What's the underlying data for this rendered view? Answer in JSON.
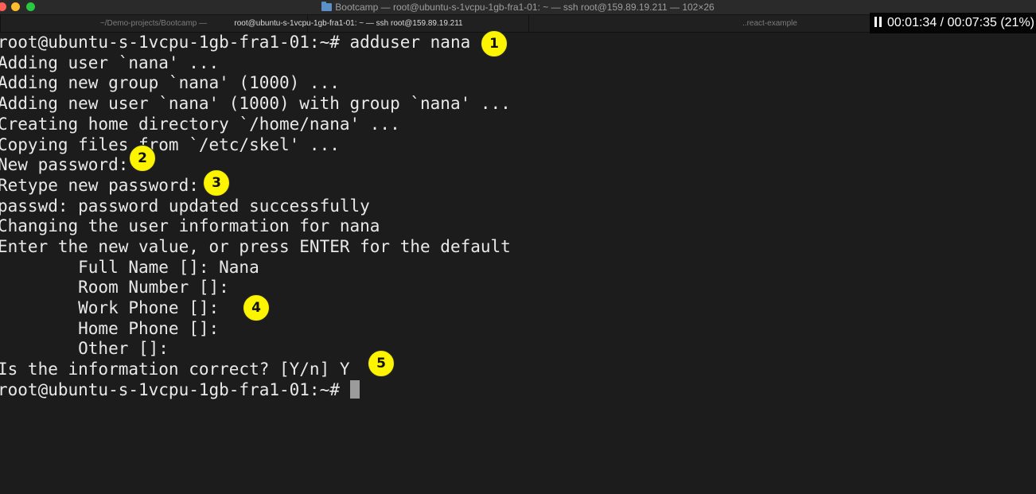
{
  "window": {
    "title": "Bootcamp — root@ubuntu-s-1vcpu-1gb-fra1-01: ~ — ssh root@159.89.19.211 — 102×26",
    "folder_icon": "folder-icon",
    "traffic_lights": [
      "#fe5f57",
      "#febc2e",
      "#28c840"
    ]
  },
  "tabs": [
    {
      "label": "~/Demo-projects/Bootcamp — ",
      "strong": "",
      "active": false
    },
    {
      "label": "",
      "strong": "root@ubuntu-s-1vcpu-1gb-fra1-01: ~ — ssh root@159.89.19.211",
      "active": true
    },
    {
      "label": "..react-example",
      "strong": "",
      "active": false
    }
  ],
  "player": {
    "icon": "pause-icon",
    "elapsed": "00:01:34",
    "separator": "/",
    "total": "00:07:35",
    "percent": "(21%)"
  },
  "terminal": {
    "lines": [
      "root@ubuntu-s-1vcpu-1gb-fra1-01:~# adduser nana",
      "Adding user `nana' ...",
      "Adding new group `nana' (1000) ...",
      "Adding new user `nana' (1000) with group `nana' ...",
      "Creating home directory `/home/nana' ...",
      "Copying files from `/etc/skel' ...",
      "New password:",
      "Retype new password:",
      "passwd: password updated successfully",
      "Changing the user information for nana",
      "Enter the new value, or press ENTER for the default",
      "        Full Name []: Nana",
      "        Room Number []:",
      "        Work Phone []:",
      "        Home Phone []:",
      "        Other []:",
      "Is the information correct? [Y/n] Y",
      "root@ubuntu-s-1vcpu-1gb-fra1-01:~# "
    ],
    "colors": {
      "background": "#1c1c1c",
      "text": "#e9e9e9",
      "cursor": "#9b9b9b"
    }
  },
  "annotations": {
    "markers": [
      "1",
      "2",
      "3",
      "4",
      "5"
    ],
    "color": "#fdf500"
  }
}
